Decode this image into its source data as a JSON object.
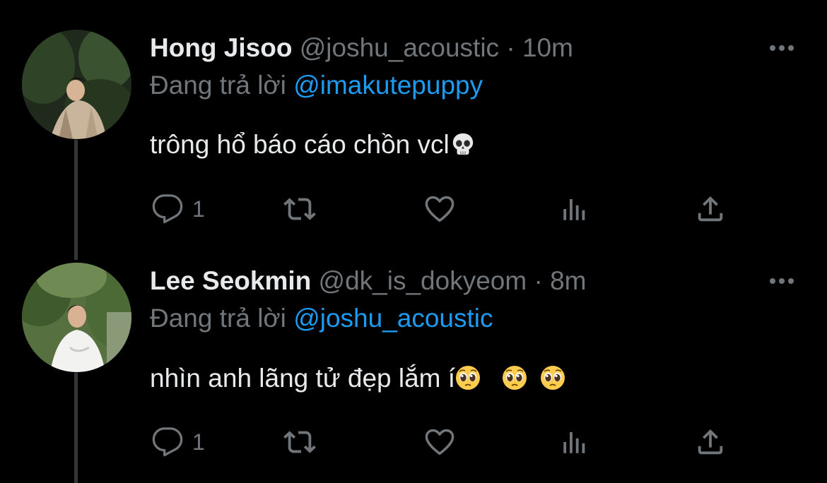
{
  "tweets": [
    {
      "name": "Hong Jisoo",
      "handle": "@joshu_acoustic",
      "separator": "·",
      "time": "10m",
      "reply_prefix": "Đang trả lời",
      "reply_to": "@imakutepuppy",
      "text": "trông hổ báo cáo chồn vcl",
      "emojis": [
        "skull-emoji"
      ],
      "reply_count": "1",
      "avatar": "person-in-plaid-shirt-among-dark-foliage"
    },
    {
      "name": "Lee Seokmin",
      "handle": "@dk_is_dokyeom",
      "separator": "·",
      "time": "8m",
      "reply_prefix": "Đang trả lời",
      "reply_to": "@joshu_acoustic",
      "text": "nhìn anh lãng tử đẹp lắm í",
      "emojis": [
        "pleading-face-emoji",
        "pleading-face-emoji",
        "pleading-face-emoji"
      ],
      "reply_count": "1",
      "avatar": "person-in-white-shirt-among-green-trees"
    }
  ],
  "icons": {
    "more": "more-horizontal-icon",
    "reply": "reply-bubble-icon",
    "retweet": "retweet-icon",
    "like": "heart-icon",
    "analytics": "analytics-bars-icon",
    "share": "share-upload-icon"
  },
  "colors": {
    "background": "#000000",
    "primary_text": "#e7e9ea",
    "secondary_text": "#71767b",
    "accent": "#1d9bf0",
    "thread_line": "#333639"
  }
}
